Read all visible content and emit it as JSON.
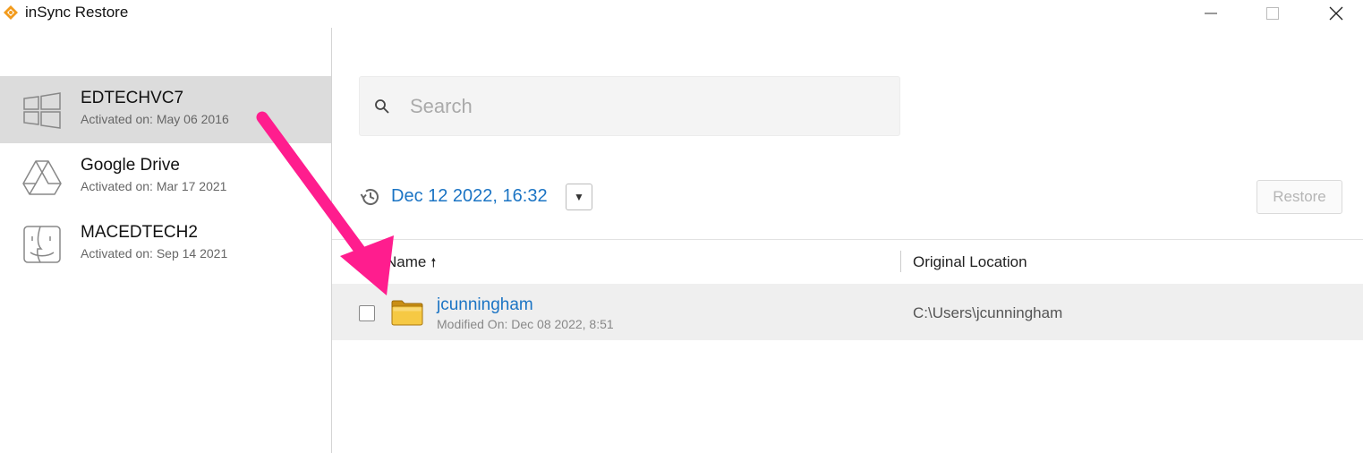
{
  "window": {
    "title": "inSync Restore"
  },
  "sources": [
    {
      "name": "EDTECHVC7",
      "activated": "Activated on: May 06 2016",
      "icon": "windows-icon"
    },
    {
      "name": "Google Drive",
      "activated": "Activated on: Mar 17 2021",
      "icon": "google-drive-icon"
    },
    {
      "name": "MACEDTECH2",
      "activated": "Activated on: Sep 14 2021",
      "icon": "mac-finder-icon"
    }
  ],
  "search": {
    "placeholder": "Search"
  },
  "snapshot": {
    "date": "Dec 12 2022, 16:32",
    "dropdown_glyph": "▼"
  },
  "toolbar": {
    "restore_label": "Restore"
  },
  "table": {
    "columns": {
      "name": "Name",
      "sort_glyph": "🠕",
      "location": "Original Location"
    },
    "rows": [
      {
        "name": "jcunningham",
        "modified": "Modified On: Dec 08 2022, 8:51",
        "location": "C:\\Users\\jcunningham",
        "icon": "folder-icon"
      }
    ]
  },
  "colors": {
    "accent": "#1b74c4",
    "annotation_arrow": "#ff1d8e",
    "selected_bg": "#dcdcdc",
    "logo": "#f29b1d"
  }
}
